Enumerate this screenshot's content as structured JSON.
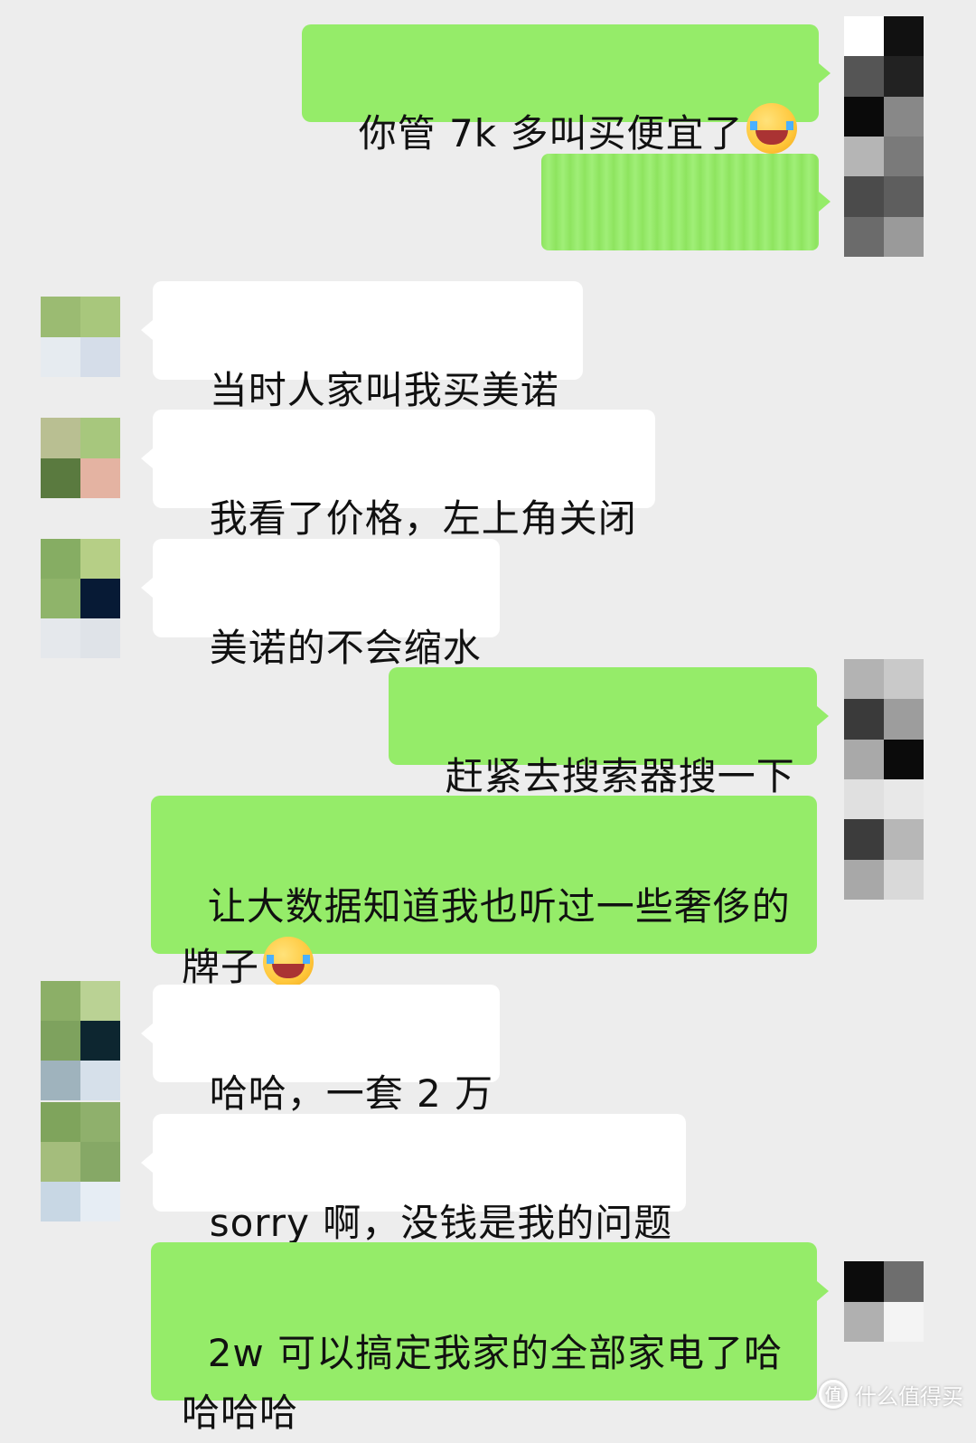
{
  "messages": [
    {
      "side": "out",
      "text": "你管 7k 多叫买便宜了",
      "emoji": "facepalm-crying-emoji"
    },
    {
      "side": "out",
      "text": "",
      "redacted": true
    },
    {
      "side": "in",
      "text": "当时人家叫我买美诺"
    },
    {
      "side": "in",
      "text": "我看了价格，左上角关闭"
    },
    {
      "side": "in",
      "text": "美诺的不会缩水"
    },
    {
      "side": "out",
      "text": "赶紧去搜索器搜一下"
    },
    {
      "side": "out",
      "text": "让大数据知道我也听过一些奢侈的\n牌子",
      "emoji": "tears-of-joy-emoji"
    },
    {
      "side": "in",
      "text": "哈哈，一套 2 万"
    },
    {
      "side": "in",
      "text": "sorry 啊，没钱是我的问题"
    },
    {
      "side": "out",
      "text": "2w 可以搞定我家的全部家电了哈\n哈哈哈"
    }
  ],
  "watermark": {
    "logo": "值",
    "text": "什么值得买"
  },
  "colors": {
    "background": "#ededed",
    "outgoing_bubble": "#95ec69",
    "incoming_bubble": "#ffffff"
  }
}
